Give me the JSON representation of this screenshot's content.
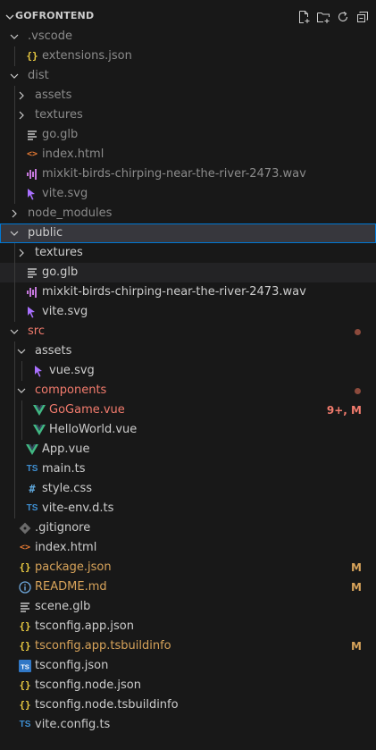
{
  "header": {
    "title": "GOFRONTEND",
    "actions": [
      "new-file",
      "new-folder",
      "refresh",
      "collapse-all"
    ]
  },
  "colors": {
    "background": "#181818",
    "selected": "#37373d",
    "selected_border": "#0078d4",
    "modified": "#d7a35a",
    "error": "#f27b6d",
    "vue": "#41b883",
    "json": "#e8c941",
    "html": "#e37933",
    "ts": "#3e8fd2",
    "wav": "#c678dd"
  },
  "tree": [
    {
      "label": ".vscode",
      "type": "folder",
      "open": true,
      "depth": 0,
      "style": "dim"
    },
    {
      "label": "extensions.json",
      "type": "json",
      "depth": 1,
      "style": "dim"
    },
    {
      "label": "dist",
      "type": "folder",
      "open": true,
      "depth": 0,
      "style": "dim"
    },
    {
      "label": "assets",
      "type": "folder",
      "open": false,
      "depth": 1,
      "style": "dim"
    },
    {
      "label": "textures",
      "type": "folder",
      "open": false,
      "depth": 1,
      "style": "dim"
    },
    {
      "label": "go.glb",
      "type": "lines",
      "depth": 1,
      "style": "dim"
    },
    {
      "label": "index.html",
      "type": "html",
      "depth": 1,
      "style": "dim"
    },
    {
      "label": "mixkit-birds-chirping-near-the-river-2473.wav",
      "type": "wav",
      "depth": 1,
      "style": "dim"
    },
    {
      "label": "vite.svg",
      "type": "svg",
      "depth": 1,
      "style": "dim"
    },
    {
      "label": "node_modules",
      "type": "folder",
      "open": false,
      "depth": 0,
      "style": "dim"
    },
    {
      "label": "public",
      "type": "folder",
      "open": true,
      "depth": 0,
      "style": "normal",
      "selected": true
    },
    {
      "label": "textures",
      "type": "folder",
      "open": false,
      "depth": 1,
      "style": "normal"
    },
    {
      "label": "go.glb",
      "type": "lines",
      "depth": 1,
      "style": "normal",
      "hover": true
    },
    {
      "label": "mixkit-birds-chirping-near-the-river-2473.wav",
      "type": "wav",
      "depth": 1,
      "style": "normal"
    },
    {
      "label": "vite.svg",
      "type": "svg",
      "depth": 1,
      "style": "normal"
    },
    {
      "label": "src",
      "type": "folder",
      "open": true,
      "depth": 0,
      "style": "red",
      "dot": true
    },
    {
      "label": "assets",
      "type": "folder",
      "open": true,
      "depth": 1,
      "style": "normal"
    },
    {
      "label": "vue.svg",
      "type": "svg",
      "depth": 2,
      "style": "normal"
    },
    {
      "label": "components",
      "type": "folder",
      "open": true,
      "depth": 1,
      "style": "red",
      "dot": true
    },
    {
      "label": "GoGame.vue",
      "type": "vue",
      "depth": 2,
      "style": "red",
      "badge": "9+, M"
    },
    {
      "label": "HelloWorld.vue",
      "type": "vue",
      "depth": 2,
      "style": "normal"
    },
    {
      "label": "App.vue",
      "type": "vue",
      "depth": 1,
      "style": "normal"
    },
    {
      "label": "main.ts",
      "type": "ts",
      "depth": 1,
      "style": "normal"
    },
    {
      "label": "style.css",
      "type": "css",
      "depth": 1,
      "style": "normal"
    },
    {
      "label": "vite-env.d.ts",
      "type": "ts",
      "depth": 1,
      "style": "normal"
    },
    {
      "label": ".gitignore",
      "type": "git",
      "depth": 0,
      "style": "normal"
    },
    {
      "label": "index.html",
      "type": "html",
      "depth": 0,
      "style": "normal"
    },
    {
      "label": "package.json",
      "type": "json",
      "depth": 0,
      "style": "orange",
      "badge": "M"
    },
    {
      "label": "README.md",
      "type": "info",
      "depth": 0,
      "style": "orange",
      "badge": "M"
    },
    {
      "label": "scene.glb",
      "type": "lines",
      "depth": 0,
      "style": "normal"
    },
    {
      "label": "tsconfig.app.json",
      "type": "json",
      "depth": 0,
      "style": "normal"
    },
    {
      "label": "tsconfig.app.tsbuildinfo",
      "type": "json",
      "depth": 0,
      "style": "orange",
      "badge": "M"
    },
    {
      "label": "tsconfig.json",
      "type": "tsconfig",
      "depth": 0,
      "style": "normal"
    },
    {
      "label": "tsconfig.node.json",
      "type": "json",
      "depth": 0,
      "style": "normal"
    },
    {
      "label": "tsconfig.node.tsbuildinfo",
      "type": "json",
      "depth": 0,
      "style": "normal"
    },
    {
      "label": "vite.config.ts",
      "type": "ts",
      "depth": 0,
      "style": "normal"
    }
  ]
}
